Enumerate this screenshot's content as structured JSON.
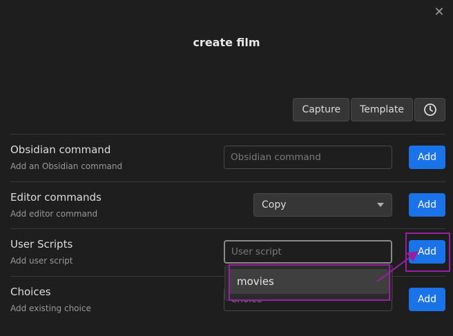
{
  "dialog": {
    "title": "create film",
    "close_icon": "close-icon"
  },
  "toolbar": {
    "capture_label": "Capture",
    "template_label": "Template",
    "clock_icon": "clock-icon"
  },
  "rows": [
    {
      "label": "Obsidian command",
      "description": "Add an Obsidian command",
      "input_placeholder": "Obsidian command",
      "add_label": "Add"
    },
    {
      "label": "Editor commands",
      "description": "Add editor command",
      "select_value": "Copy",
      "add_label": "Add"
    },
    {
      "label": "User Scripts",
      "description": "Add user script",
      "input_placeholder": "User script",
      "add_label": "Add"
    },
    {
      "label": "Choices",
      "description": "Add existing choice",
      "input_placeholder": "Choice",
      "add_label": "Add"
    }
  ],
  "suggestion": {
    "items": [
      "movies"
    ]
  },
  "colors": {
    "accent": "#1a73e8",
    "highlight": "#9b1fa3",
    "background": "#1e1e1e"
  }
}
